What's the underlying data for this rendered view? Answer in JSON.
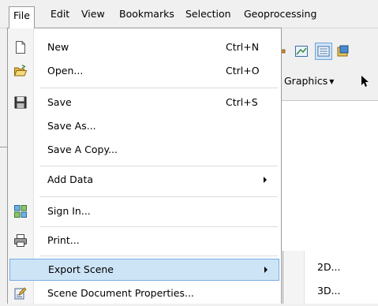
{
  "menubar": {
    "items": [
      "File",
      "Edit",
      "View",
      "Bookmarks",
      "Selection",
      "Geoprocessing"
    ]
  },
  "toolbar": {
    "graphics_label": "Graphics"
  },
  "file_menu": {
    "items": [
      {
        "label": "New",
        "shortcut": "Ctrl+N",
        "icon": "new-document-icon"
      },
      {
        "label": "Open...",
        "shortcut": "Ctrl+O",
        "icon": "open-folder-icon"
      },
      {
        "label": "Save",
        "shortcut": "Ctrl+S",
        "icon": "save-disk-icon"
      },
      {
        "label": "Save As...",
        "shortcut": "",
        "icon": ""
      },
      {
        "label": "Save A Copy...",
        "shortcut": "",
        "icon": ""
      },
      {
        "label": "Add Data",
        "shortcut": "",
        "icon": "",
        "submenu": true
      },
      {
        "label": "Sign In...",
        "shortcut": "",
        "icon": "sign-in-icon"
      },
      {
        "label": "Print...",
        "shortcut": "",
        "icon": "printer-icon"
      },
      {
        "label": "Export Scene",
        "shortcut": "",
        "icon": "",
        "submenu": true,
        "highlighted": true
      },
      {
        "label": "Scene Document Properties...",
        "shortcut": "",
        "icon": "document-properties-icon"
      }
    ]
  },
  "export_submenu": {
    "items": [
      "2D...",
      "3D..."
    ]
  },
  "colors": {
    "menu_bg": "#ffffff",
    "highlight_bg": "#cde4f7",
    "highlight_border": "#78aee5",
    "chrome_bg": "#f0f0f0"
  }
}
